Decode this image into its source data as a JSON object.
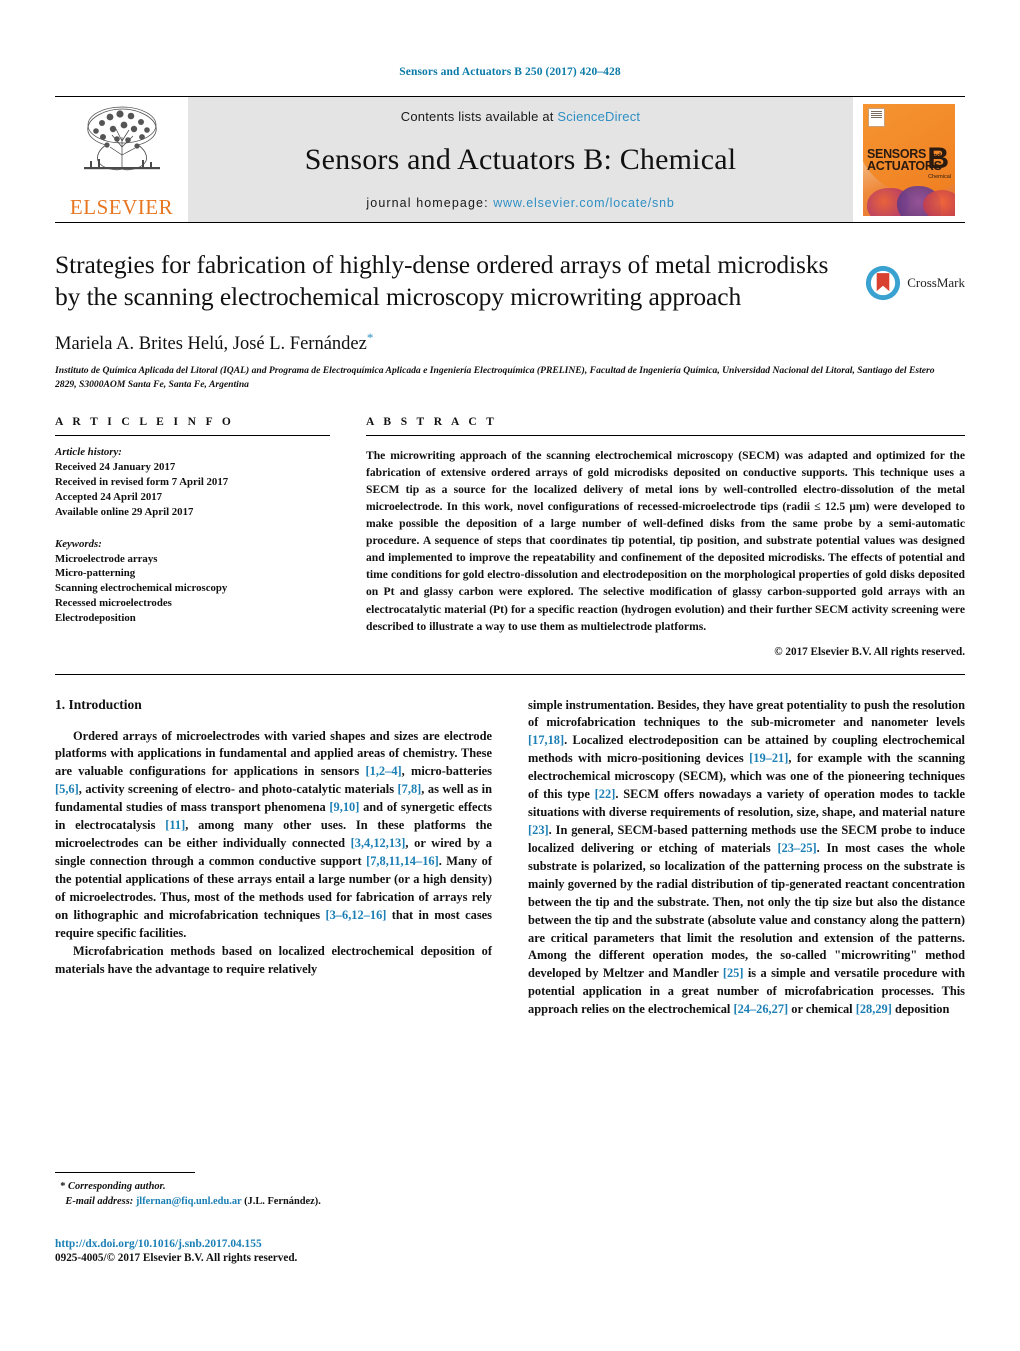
{
  "running_head": "Sensors and Actuators B 250 (2017) 420–428",
  "masthead": {
    "publisher": "ELSEVIER",
    "contents_prefix": "Contents lists available at ",
    "contents_link": "ScienceDirect",
    "journal_title": "Sensors and Actuators B: Chemical",
    "homepage_prefix": "journal homepage: ",
    "homepage_link": "www.elsevier.com/locate/snb",
    "cover": {
      "line1": "SENSORS",
      "line1_small": "and",
      "line2": "ACTUATORS",
      "letter": "B",
      "letter_sub": "Chemical"
    }
  },
  "article": {
    "title": "Strategies for fabrication of highly-dense ordered arrays of metal microdisks by the scanning electrochemical microscopy microwriting approach",
    "crossmark_label": "CrossMark",
    "authors": "Mariela A. Brites Helú, José L. Fernández",
    "author_marker": "*",
    "affiliation": "Instituto de Química Aplicada del Litoral (IQAL) and Programa de Electroquímica Aplicada e Ingeniería Electroquímica (PRELINE), Facultad de Ingeniería Química, Universidad Nacional del Litoral, Santiago del Estero 2829, S3000AOM Santa Fe, Santa Fe, Argentina"
  },
  "info": {
    "heading": "A R T I C L E   I N F O",
    "history_label": "Article history:",
    "history": [
      "Received 24 January 2017",
      "Received in revised form 7 April 2017",
      "Accepted 24 April 2017",
      "Available online 29 April 2017"
    ],
    "keywords_label": "Keywords:",
    "keywords": [
      "Microelectrode arrays",
      "Micro-patterning",
      "Scanning electrochemical microscopy",
      "Recessed microelectrodes",
      "Electrodeposition"
    ]
  },
  "abstract": {
    "heading": "A B S T R A C T",
    "text": "The microwriting approach of the scanning electrochemical microscopy (SECM) was adapted and optimized for the fabrication of extensive ordered arrays of gold microdisks deposited on conductive supports. This technique uses a SECM tip as a source for the localized delivery of metal ions by well-controlled electro-dissolution of the metal microelectrode. In this work, novel configurations of recessed-microelectrode tips (radii ≤ 12.5 μm) were developed to make possible the deposition of a large number of well-defined disks from the same probe by a semi-automatic procedure. A sequence of steps that coordinates tip potential, tip position, and substrate potential values was designed and implemented to improve the repeatability and confinement of the deposited microdisks. The effects of potential and time conditions for gold electro-dissolution and electrodeposition on the morphological properties of gold disks deposited on Pt and glassy carbon were explored. The selective modification of glassy carbon-supported gold arrays with an electrocatalytic material (Pt) for a specific reaction (hydrogen evolution) and their further SECM activity screening were described to illustrate a way to use them as multielectrode platforms.",
    "copyright": "© 2017 Elsevier B.V. All rights reserved."
  },
  "body": {
    "section_number_title": "1.  Introduction",
    "left_paragraph_1_parts": [
      {
        "t": "Ordered arrays of microelectrodes with varied shapes and sizes are electrode platforms with applications in fundamental and applied areas of chemistry. These are valuable configurations for applications in sensors "
      },
      {
        "r": "[1,2–4]"
      },
      {
        "t": ", micro-batteries "
      },
      {
        "r": "[5,6]"
      },
      {
        "t": ", activity screening of electro- and photo-catalytic materials "
      },
      {
        "r": "[7,8]"
      },
      {
        "t": ", as well as in fundamental studies of mass transport phenomena "
      },
      {
        "r": "[9,10]"
      },
      {
        "t": " and of synergetic effects in electrocatalysis "
      },
      {
        "r": "[11]"
      },
      {
        "t": ", among many other uses. In these platforms the microelectrodes can be either individually connected "
      },
      {
        "r": "[3,4,12,13]"
      },
      {
        "t": ", or wired by a single connection through a common conductive support "
      },
      {
        "r": "[7,8,11,14–16]"
      },
      {
        "t": ". Many of the potential applications of these arrays entail a large number (or a high density) of microelectrodes. Thus, most of the methods used for fabrication of arrays rely on lithographic and microfabrication techniques "
      },
      {
        "r": "[3–6,12–16]"
      },
      {
        "t": " that in most cases require specific facilities."
      }
    ],
    "left_paragraph_2_parts": [
      {
        "t": "Microfabrication methods based on localized electrochemical deposition of materials have the advantage to require relatively"
      }
    ],
    "right_paragraph_parts": [
      {
        "t": "simple instrumentation. Besides, they have great potentiality to push the resolution of microfabrication techniques to the sub-micrometer and nanometer levels "
      },
      {
        "r": "[17,18]"
      },
      {
        "t": ". Localized electrodeposition can be attained by coupling electrochemical methods with micro-positioning devices "
      },
      {
        "r": "[19–21]"
      },
      {
        "t": ", for example with the scanning electrochemical microscopy (SECM), which was one of the pioneering techniques of this type "
      },
      {
        "r": "[22]"
      },
      {
        "t": ". SECM offers nowadays a variety of operation modes to tackle situations with diverse requirements of resolution, size, shape, and material nature "
      },
      {
        "r": "[23]"
      },
      {
        "t": ". In general, SECM-based patterning methods use the SECM probe to induce localized delivering or etching of materials "
      },
      {
        "r": "[23–25]"
      },
      {
        "t": ". In most cases the whole substrate is polarized, so localization of the patterning process on the substrate is mainly governed by the radial distribution of tip-generated reactant concentration between the tip and the substrate. Then, not only the tip size but also the distance between the tip and the substrate (absolute value and constancy along the pattern) are critical parameters that limit the resolution and extension of the patterns. Among the different operation modes, the so-called \"microwriting\" method developed by Meltzer and Mandler "
      },
      {
        "r": "[25]"
      },
      {
        "t": " is a simple and versatile procedure with potential application in a great number of microfabrication processes. This approach relies on the electrochemical "
      },
      {
        "r": "[24–26,27]"
      },
      {
        "t": " or chemical "
      },
      {
        "r": "[28,29]"
      },
      {
        "t": " deposition"
      }
    ]
  },
  "footnotes": {
    "corresponding_marker": "*",
    "corresponding_label": "Corresponding author.",
    "email_label": "E-mail address:",
    "email": "jlfernan@fiq.unl.edu.ar",
    "email_suffix": "(J.L. Fernández).",
    "doi": "http://dx.doi.org/10.1016/j.snb.2017.04.155",
    "issn_line": "0925-4005/© 2017 Elsevier B.V. All rights reserved."
  },
  "colors": {
    "link_blue": "#1b7fb5",
    "elsevier_orange": "#e87722",
    "banner_grey": "#e4e4e4"
  }
}
